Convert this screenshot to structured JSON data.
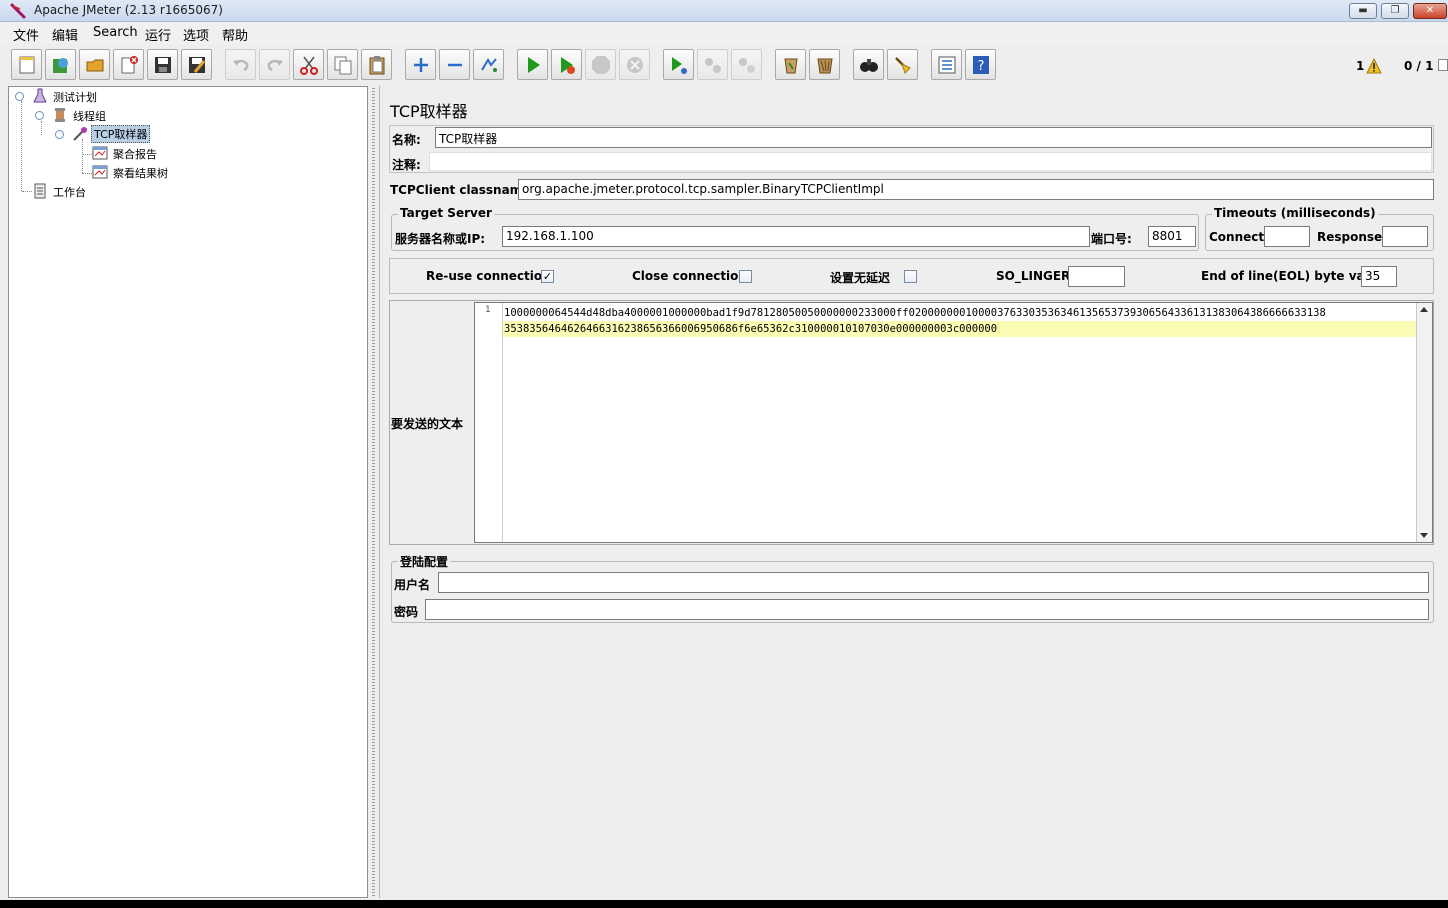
{
  "window": {
    "title": "Apache JMeter (2.13 r1665067)",
    "min_label": "▬",
    "max_label": "❐",
    "close_label": "✕"
  },
  "menu": [
    "文件",
    "编辑",
    "Search",
    "运行",
    "选项",
    "帮助"
  ],
  "toolbar": {
    "buttons": [
      {
        "name": "new-icon"
      },
      {
        "name": "templates-icon"
      },
      {
        "name": "open-icon"
      },
      {
        "name": "close-icon"
      },
      {
        "name": "save-icon"
      },
      {
        "name": "save-as-icon"
      },
      {
        "name": "undo-icon"
      },
      {
        "name": "redo-icon"
      },
      {
        "name": "cut-icon"
      },
      {
        "name": "copy-icon"
      },
      {
        "name": "paste-icon"
      },
      {
        "name": "expand-icon"
      },
      {
        "name": "collapse-icon"
      },
      {
        "name": "toggle-icon"
      },
      {
        "name": "start-icon"
      },
      {
        "name": "start-no-pause-icon"
      },
      {
        "name": "stop-icon"
      },
      {
        "name": "shutdown-icon"
      },
      {
        "name": "remote-start-icon"
      },
      {
        "name": "remote-stop-icon"
      },
      {
        "name": "remote-shutdown-icon"
      },
      {
        "name": "clear-icon"
      },
      {
        "name": "clear-all-icon"
      },
      {
        "name": "search-icon"
      },
      {
        "name": "reset-search-icon"
      },
      {
        "name": "function-helper-icon"
      },
      {
        "name": "help-icon"
      }
    ],
    "warning_count": "1",
    "threads": "0 / 1"
  },
  "tree": {
    "items": [
      {
        "label": "测试计划"
      },
      {
        "label": "线程组"
      },
      {
        "label": "TCP取样器"
      },
      {
        "label": "聚合报告"
      },
      {
        "label": "察看结果树"
      },
      {
        "label": "工作台"
      }
    ]
  },
  "sampler": {
    "heading": "TCP取样器",
    "name_label": "名称:",
    "name_value": "TCP取样器",
    "comment_label": "注释:",
    "comment_value": "",
    "classname_label": "TCPClient classname:",
    "classname_value": "org.apache.jmeter.protocol.tcp.sampler.BinaryTCPClientImpl",
    "target_server": {
      "title": "Target Server",
      "server_label": "服务器名称或IP:",
      "server_value": "192.168.1.100",
      "port_label": "端口号:",
      "port_value": "8801"
    },
    "timeouts": {
      "title": "Timeouts (milliseconds)",
      "connect_label": "Connect:",
      "connect_value": "",
      "response_label": "Response:",
      "response_value": ""
    },
    "options": {
      "reuse_label": "Re-use connection",
      "reuse_checked": true,
      "close_label": "Close connection",
      "close_checked": false,
      "nodelay_label": "设置无延迟",
      "nodelay_checked": false,
      "solinger_label": "SO_LINGER:",
      "solinger_value": "",
      "eol_label": "End of line(EOL) byte value:",
      "eol_value": "35"
    },
    "text_to_send": {
      "label": "要发送的文本",
      "line_number": "1",
      "line1": "1000000064544d48dba4000001000000bad1f9d78128050050000000233000ff020000000100003763303536346135653739306564336131383064386666633138",
      "line2": "3538356464626466316238656366006950686f6e65362c310000010107030e000000003c000000"
    },
    "login": {
      "title": "登陆配置",
      "username_label": "用户名",
      "username_value": "",
      "password_label": "密码",
      "password_value": ""
    }
  }
}
